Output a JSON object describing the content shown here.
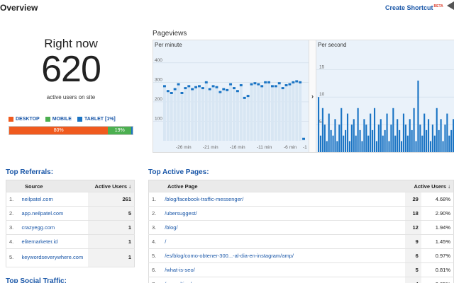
{
  "header": {
    "title": "Overview",
    "create_shortcut": "Create Shortcut",
    "beta": "BETA"
  },
  "right_now": {
    "title": "Right now",
    "count": "620",
    "subtitle": "active users on site"
  },
  "devices": {
    "legend": [
      {
        "label": "DESKTOP",
        "color": "#f05a1e"
      },
      {
        "label": "MOBILE",
        "color": "#4caf50"
      },
      {
        "label": "TABLET [1%]",
        "color": "#1a74c4"
      }
    ],
    "segments": [
      {
        "label": "80%",
        "percent": 80,
        "color": "#f05a1e"
      },
      {
        "label": "19%",
        "percent": 19,
        "color": "#4caf50"
      },
      {
        "label": "",
        "percent": 1,
        "color": "#1a74c4"
      }
    ]
  },
  "pageviews": {
    "label": "Pageviews",
    "per_minute_label": "Per minute",
    "per_second_label": "Per second",
    "arrow": "›"
  },
  "chart_data": [
    {
      "type": "bar",
      "title": "Per minute",
      "ylim": [
        0,
        450
      ],
      "y_ticks": [
        "100",
        "200",
        "300",
        "400"
      ],
      "x_ticks": [
        "-26 min",
        "-21 min",
        "-16 min",
        "-11 min",
        "-6 min",
        "-1"
      ],
      "values": [
        280,
        255,
        245,
        265,
        290,
        245,
        270,
        280,
        265,
        275,
        280,
        270,
        300,
        265,
        280,
        275,
        250,
        265,
        260,
        290,
        270,
        255,
        285,
        220,
        230,
        290,
        295,
        290,
        280,
        300,
        300,
        280,
        280,
        295,
        270,
        285,
        290,
        300,
        305,
        300,
        10
      ],
      "color": "#1a74c4"
    },
    {
      "type": "bar",
      "title": "Per second",
      "ylim": [
        0,
        18
      ],
      "y_ticks": [
        "5",
        "10",
        "15"
      ],
      "values": [
        10,
        3,
        8,
        5,
        2,
        7,
        4,
        3,
        6,
        2,
        5,
        8,
        3,
        4,
        7,
        2,
        5,
        6,
        3,
        8,
        4,
        2,
        6,
        5,
        3,
        7,
        4,
        8,
        2,
        5,
        6,
        3,
        4,
        7,
        2,
        5,
        8,
        3,
        6,
        4,
        2,
        7,
        5,
        3,
        6,
        4,
        8,
        2,
        13,
        5,
        3,
        7,
        4,
        6,
        2,
        5,
        3,
        8,
        4,
        6,
        2,
        5,
        7,
        3,
        4,
        6
      ],
      "color": "#1a74c4"
    }
  ],
  "referrals": {
    "title": "Top Referrals:",
    "col_source": "Source",
    "col_users": "Active Users",
    "rows": [
      {
        "idx": "1.",
        "source": "neilpatel.com",
        "users": "261"
      },
      {
        "idx": "2.",
        "source": "app.neilpatel.com",
        "users": "5"
      },
      {
        "idx": "3.",
        "source": "crazyegg.com",
        "users": "1"
      },
      {
        "idx": "4.",
        "source": "elitemarketer.id",
        "users": "1"
      },
      {
        "idx": "5.",
        "source": "keywordseverywhere.com",
        "users": "1"
      }
    ]
  },
  "pages": {
    "title": "Top Active Pages:",
    "col_page": "Active Page",
    "col_users": "Active Users",
    "rows": [
      {
        "idx": "1.",
        "page": "/blog/facebook-traffic-messenger/",
        "users": "29",
        "pct": "4.68%"
      },
      {
        "idx": "2.",
        "page": "/ubersuggest/",
        "users": "18",
        "pct": "2.90%"
      },
      {
        "idx": "3.",
        "page": "/blog/",
        "users": "12",
        "pct": "1.94%"
      },
      {
        "idx": "4.",
        "page": "/",
        "users": "9",
        "pct": "1.45%"
      },
      {
        "idx": "5.",
        "page": "/es/blog/como-obtener-300...-al-dia-en-instagram/amp/",
        "users": "6",
        "pct": "0.97%"
      },
      {
        "idx": "6.",
        "page": "/what-is-seo/",
        "users": "5",
        "pct": "0.81%"
      },
      {
        "idx": "7.",
        "page": "/consulting/",
        "users": "4",
        "pct": "0.65%"
      }
    ]
  },
  "social": {
    "title": "Top Social Traffic:"
  }
}
